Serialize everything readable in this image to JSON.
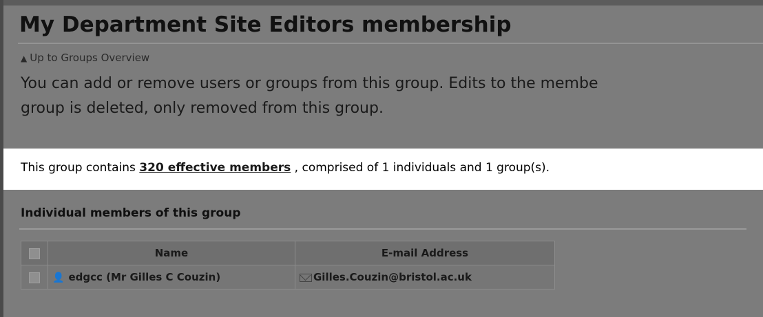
{
  "page": {
    "title": "My Department Site Editors membership",
    "up_link": "Up to Groups Overview",
    "intro_line1": "You can add or remove users or groups from this group. Edits to the membe",
    "intro_line2": "group is deleted, only removed from this group."
  },
  "summary": {
    "prefix": "This group contains ",
    "link_text": "320 effective members",
    "suffix": " , comprised of 1 individuals and 1 group(s)."
  },
  "members": {
    "section_title": "Individual members of this group",
    "columns": [
      "Name",
      "E-mail Address"
    ],
    "rows": [
      {
        "name": "edgcc (Mr Gilles C Couzin)",
        "email": "Gilles.Couzin@bristol.ac.uk"
      }
    ]
  },
  "colors": {
    "dimmed_overlay": "#7c7c7c",
    "highlight": "#ffffff"
  }
}
